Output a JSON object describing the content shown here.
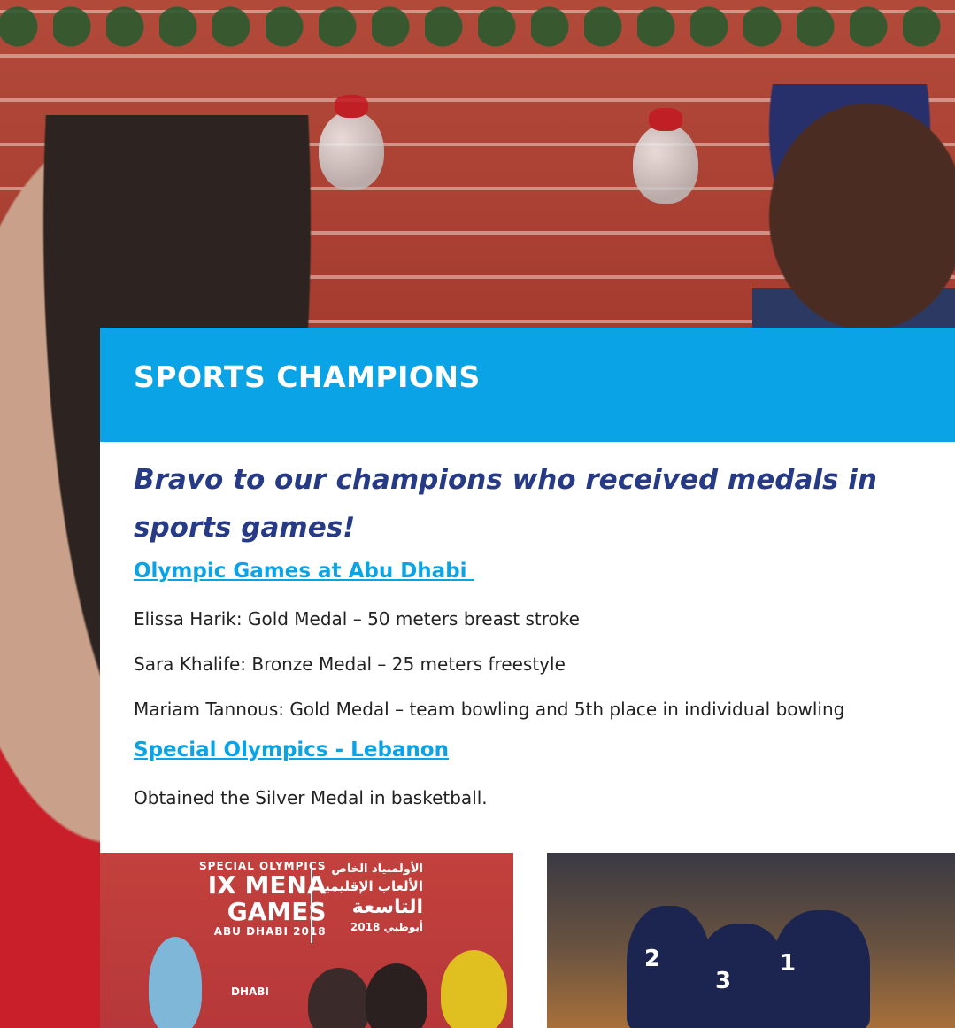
{
  "section": {
    "title": "SPORTS CHAMPIONS",
    "intro": "Bravo to our champions who received medals in sports games!"
  },
  "olympic_games": {
    "heading": "Olympic Games at Abu Dhabi ",
    "results": [
      "Elissa Harik: Gold Medal – 50 meters breast stroke",
      "Sara Khalife: Bronze Medal – 25 meters freestyle",
      "Mariam Tannous: Gold Medal – team bowling and 5th place in individual bowling"
    ]
  },
  "special_olympics": {
    "heading": "Special Olympics - Lebanon",
    "result": "Obtained the Silver Medal in basketball."
  },
  "photo_left": {
    "banner_small": "SPECIAL OLYMPICS",
    "banner_line1": "IX MENA",
    "banner_line2": "GAMES",
    "banner_small2": "ABU DHABI 2018",
    "banner_arabic_1": "الأولمبياد الخاص",
    "banner_arabic_2": "الألعاب الإقليمية",
    "banner_arabic_3": "التاسعة",
    "banner_arabic_4": "أبوظبي 2018",
    "sign_text": "DHABI"
  },
  "photo_right": {
    "jersey_numbers": [
      "2",
      "3",
      "1"
    ]
  },
  "colors": {
    "accent_blue": "#0aa4e6",
    "heading_navy": "#263a86"
  }
}
